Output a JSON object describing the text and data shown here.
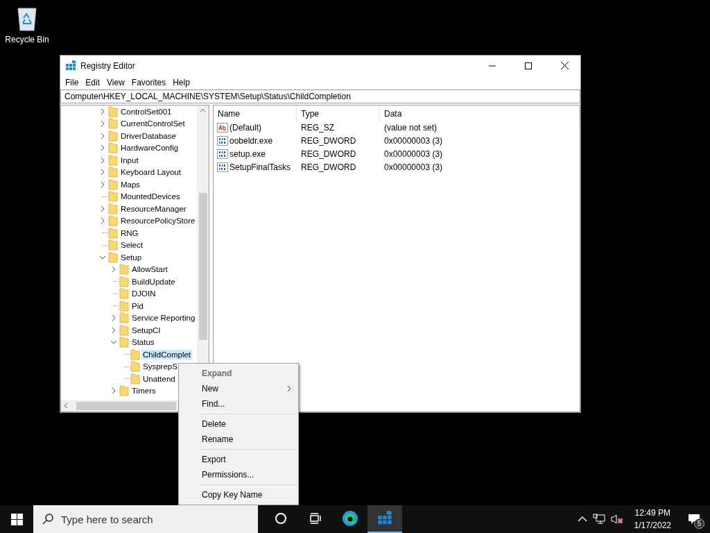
{
  "desktop_icons": [
    {
      "label": "Recycle Bin"
    }
  ],
  "window": {
    "title": "Registry Editor",
    "menu": [
      "File",
      "Edit",
      "View",
      "Favorites",
      "Help"
    ],
    "address": "Computer\\HKEY_LOCAL_MACHINE\\SYSTEM\\Setup\\Status\\ChildCompletion",
    "tree": [
      {
        "label": "ControlSet001",
        "expanded": false,
        "selected": false
      },
      {
        "label": "CurrentControlSet",
        "expanded": false,
        "selected": false
      },
      {
        "label": "DriverDatabase",
        "expanded": false,
        "selected": false
      },
      {
        "label": "HardwareConfig",
        "expanded": false,
        "selected": false
      },
      {
        "label": "Input",
        "expanded": false,
        "selected": false
      },
      {
        "label": "Keyboard Layout",
        "expanded": false,
        "selected": false
      },
      {
        "label": "Maps",
        "expanded": false,
        "selected": false
      },
      {
        "label": "MountedDevices",
        "selected": false
      },
      {
        "label": "ResourceManager",
        "expanded": false,
        "selected": false
      },
      {
        "label": "ResourcePolicyStore",
        "expanded": false,
        "selected": false
      },
      {
        "label": "RNG",
        "selected": false
      },
      {
        "label": "Select",
        "selected": false
      },
      {
        "label": "Setup",
        "expanded": true,
        "selected": false,
        "children": [
          {
            "label": "AllowStart",
            "expanded": false,
            "selected": false
          },
          {
            "label": "BuildUpdate",
            "selected": false
          },
          {
            "label": "DJOIN",
            "selected": false
          },
          {
            "label": "Pid",
            "selected": false
          },
          {
            "label": "Service Reporting",
            "expanded": false,
            "selected": false
          },
          {
            "label": "SetupCI",
            "expanded": false,
            "selected": false
          },
          {
            "label": "Status",
            "expanded": true,
            "selected": false,
            "children": [
              {
                "label": "ChildComplet",
                "selected": true
              },
              {
                "label": "SysprepS",
                "selected": false
              },
              {
                "label": "Unattend",
                "selected": false
              }
            ]
          },
          {
            "label": "Timers",
            "expanded": false,
            "selected": false
          }
        ]
      }
    ],
    "columns": [
      "Name",
      "Type",
      "Data"
    ],
    "values": [
      {
        "kind": "string",
        "name": "(Default)",
        "type": "REG_SZ",
        "data": "(value not set)"
      },
      {
        "kind": "binary",
        "name": "oobeldr.exe",
        "type": "REG_DWORD",
        "data": "0x00000003 (3)"
      },
      {
        "kind": "binary",
        "name": "setup.exe",
        "type": "REG_DWORD",
        "data": "0x00000003 (3)"
      },
      {
        "kind": "binary",
        "name": "SetupFinalTasks",
        "type": "REG_DWORD",
        "data": "0x00000003 (3)"
      }
    ]
  },
  "context_menu": [
    {
      "kind": "item",
      "label": "Expand",
      "disabled": true,
      "default": true,
      "submenu": false
    },
    {
      "kind": "item",
      "label": "New",
      "disabled": false,
      "default": false,
      "submenu": true
    },
    {
      "kind": "item",
      "label": "Find...",
      "disabled": false,
      "default": false,
      "submenu": false
    },
    {
      "kind": "separator"
    },
    {
      "kind": "item",
      "label": "Delete",
      "disabled": false,
      "default": false,
      "submenu": false
    },
    {
      "kind": "item",
      "label": "Rename",
      "disabled": false,
      "default": false,
      "submenu": false
    },
    {
      "kind": "separator"
    },
    {
      "kind": "item",
      "label": "Export",
      "disabled": false,
      "default": false,
      "submenu": false
    },
    {
      "kind": "item",
      "label": "Permissions...",
      "disabled": false,
      "default": false,
      "submenu": false
    },
    {
      "kind": "separator"
    },
    {
      "kind": "item",
      "label": "Copy Key Name",
      "disabled": false,
      "default": false,
      "submenu": false
    }
  ],
  "taskbar": {
    "search_placeholder": "Type here to search",
    "apps": [
      {
        "kind": "edge",
        "selected": false
      },
      {
        "kind": "regedit",
        "selected": true
      }
    ],
    "time": "12:49 PM",
    "date": "1/17/2022",
    "notifications": "5"
  }
}
